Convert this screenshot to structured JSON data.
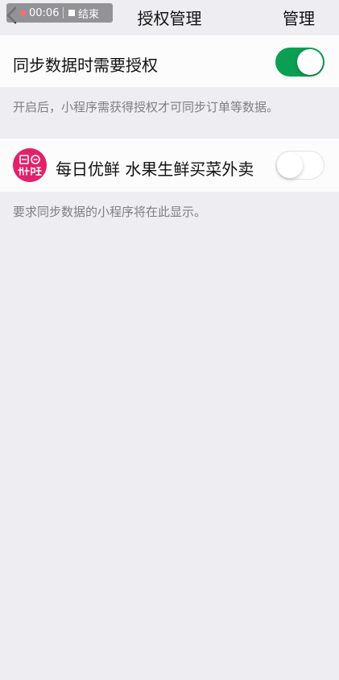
{
  "status_overlay": {
    "timer": "00:06",
    "end_label": "结束"
  },
  "header": {
    "title": "授权管理",
    "manage_label": "管理"
  },
  "setting": {
    "label": "同步数据时需要授权",
    "enabled": true,
    "description": "开启后，小程序需获得授权才可同步订单等数据。"
  },
  "apps": [
    {
      "name": "每日优鲜 水果生鲜买菜外卖",
      "icon": "missfresh-logo",
      "enabled": false
    }
  ],
  "apps_footnote": "要求同步数据的小程序将在此显示。",
  "colors": {
    "switch_on": "#0a9f53",
    "app_icon": "#e4206b",
    "background": "#ededf2"
  }
}
